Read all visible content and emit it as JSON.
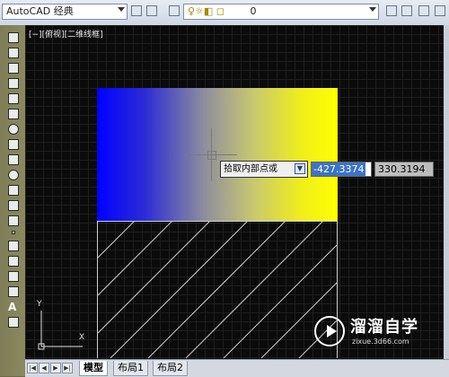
{
  "toolbar": {
    "workspace": "AutoCAD 经典",
    "layer_value": "0"
  },
  "viewport_label": "[−][俯视][二维线框]",
  "command_prompt": {
    "text": "拾取内部点或",
    "x_value": "-427.3374",
    "y_value": "330.3194"
  },
  "ucs": {
    "y_label": "Y",
    "x_label": "X"
  },
  "watermark": {
    "title": "溜溜自学",
    "url": "zixue.3d66.com"
  },
  "tabs": [
    "模型",
    "布局1",
    "布局2"
  ],
  "colors": {
    "drawing_bg": "#0b0b0b",
    "gradient_start": "#0000ff",
    "gradient_end": "#ffff00",
    "hatch": "#cfcfcf"
  }
}
